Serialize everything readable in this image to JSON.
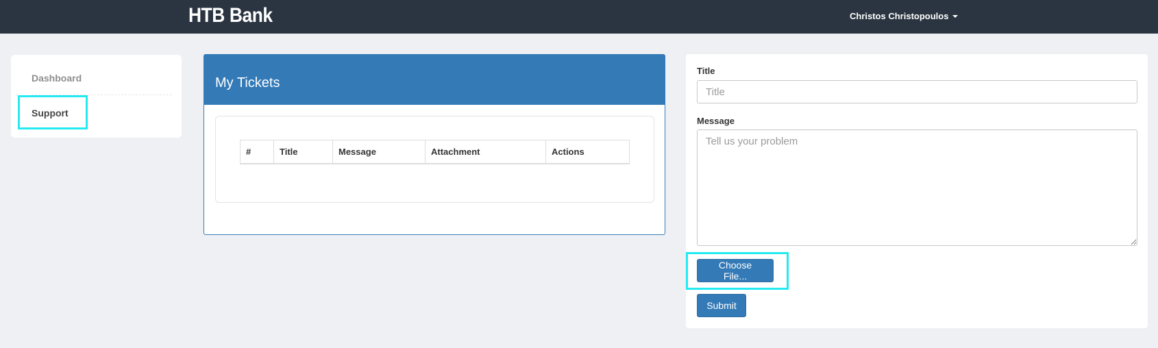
{
  "navbar": {
    "brand": "HTB Bank",
    "user_name": "Christos Christopoulos"
  },
  "sidebar": {
    "items": [
      {
        "label": "Dashboard"
      },
      {
        "label": "Support"
      }
    ]
  },
  "tickets": {
    "title": "My Tickets",
    "columns": [
      "#",
      "Title",
      "Message",
      "Attachment",
      "Actions"
    ],
    "rows": []
  },
  "form": {
    "title_label": "Title",
    "title_placeholder": "Title",
    "title_value": "",
    "message_label": "Message",
    "message_placeholder": "Tell us your problem",
    "message_value": "",
    "choose_file_label": "Choose File...",
    "submit_label": "Submit"
  },
  "colors": {
    "navbar_bg": "#2b3541",
    "primary": "#337ab7",
    "highlight": "#22eaf0",
    "page_bg": "#eef0f4"
  },
  "icons": {
    "user_menu": "caret-down-icon"
  }
}
